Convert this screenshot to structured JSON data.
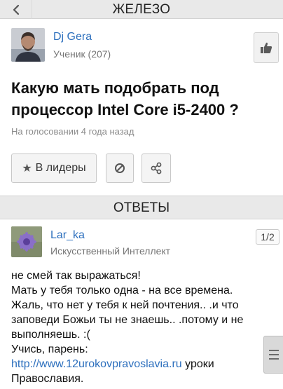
{
  "header": {
    "back_icon": "chevron-left-icon",
    "title": "ЖЕЛЕЗО"
  },
  "question": {
    "author": {
      "name": "Dj Gera",
      "rank": "Ученик (207)"
    },
    "title": "Какую мать подобрать под процессор Intel Core i5-2400 ?",
    "meta": "На голосовании 4 года назад",
    "actions": {
      "leaders_label": "В лидеры"
    }
  },
  "answers_header": "ОТВЕТЫ",
  "answer": {
    "author": {
      "name": "Lar_ka",
      "rank": "Искусственный Интеллект"
    },
    "pager": "1/2",
    "lines": [
      "не смей так выражаться!",
      "Мать у тебя только одна - на все времена.",
      "Жаль, что нет у тебя к ней почтения.. .и что заповеди Божьи ты не знаешь.. .потому и не выполняешь. :(",
      "Учись, парень:"
    ],
    "link": "http://www.12urokovpravoslavia.ru",
    "link_suffix": " уроки Православия."
  },
  "colors": {
    "link": "#2c6fbd",
    "bar": "#e9e9e9",
    "meta": "#8a8a8a"
  }
}
